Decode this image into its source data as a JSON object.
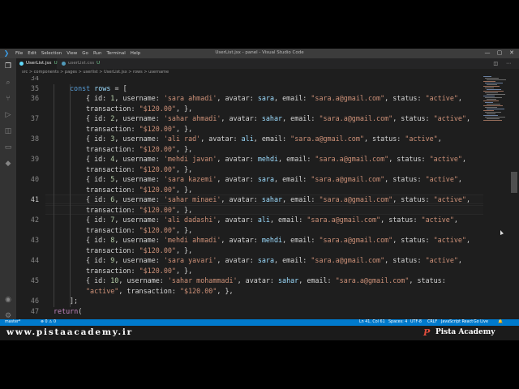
{
  "window": {
    "title": "UserList.jsx - panel - Visual Studio Code",
    "menu": [
      "File",
      "Edit",
      "Selection",
      "View",
      "Go",
      "Run",
      "Terminal",
      "Help"
    ],
    "watermark": "Pista Academy"
  },
  "tabs": [
    {
      "label": "UserList.jsx",
      "status": "U",
      "active": true
    },
    {
      "label": "userList.css",
      "status": "U",
      "active": false
    }
  ],
  "breadcrumb": "src > components > pages > userlist > UserList.jsx > rows > username",
  "code_lines": [
    {
      "num": "34",
      "indent": 0,
      "tokens": []
    },
    {
      "num": "35",
      "indent": 1,
      "tokens": [
        [
          "k",
          "const "
        ],
        [
          "v",
          "rows"
        ],
        [
          "p",
          " = ["
        ]
      ]
    },
    {
      "num": "36",
      "indent": 2,
      "tokens": [
        [
          "p",
          "{ id: "
        ],
        [
          "n",
          "1"
        ],
        [
          "p",
          ", username: "
        ],
        [
          "s",
          "'sara ahmadi'"
        ],
        [
          "p",
          ", avatar: "
        ],
        [
          "v",
          "sara"
        ],
        [
          "p",
          ", email: "
        ],
        [
          "s",
          "\"sara.a@gmail.com\""
        ],
        [
          "p",
          ", status: "
        ],
        [
          "s",
          "\"active\""
        ],
        [
          "p",
          ","
        ]
      ]
    },
    {
      "num": "",
      "indent": 2,
      "tokens": [
        [
          "p",
          "transaction: "
        ],
        [
          "s",
          "\"$120.00\""
        ],
        [
          "p",
          ", },"
        ]
      ]
    },
    {
      "num": "37",
      "indent": 2,
      "tokens": [
        [
          "p",
          "{ id: "
        ],
        [
          "n",
          "2"
        ],
        [
          "p",
          ", username: "
        ],
        [
          "s",
          "'sahar ahmadi'"
        ],
        [
          "p",
          ", avatar: "
        ],
        [
          "v",
          "sahar"
        ],
        [
          "p",
          ", email: "
        ],
        [
          "s",
          "\"sara.a@gmail.com\""
        ],
        [
          "p",
          ", status: "
        ],
        [
          "s",
          "\"active\""
        ],
        [
          "p",
          ","
        ]
      ]
    },
    {
      "num": "",
      "indent": 2,
      "tokens": [
        [
          "p",
          "transaction: "
        ],
        [
          "s",
          "\"$120.00\""
        ],
        [
          "p",
          ", },"
        ]
      ]
    },
    {
      "num": "38",
      "indent": 2,
      "tokens": [
        [
          "p",
          "{ id: "
        ],
        [
          "n",
          "3"
        ],
        [
          "p",
          ", username: "
        ],
        [
          "s",
          "'ali rad'"
        ],
        [
          "p",
          ", avatar: "
        ],
        [
          "v",
          "ali"
        ],
        [
          "p",
          ", email: "
        ],
        [
          "s",
          "\"sara.a@gmail.com\""
        ],
        [
          "p",
          ", status: "
        ],
        [
          "s",
          "\"active\""
        ],
        [
          "p",
          ","
        ]
      ]
    },
    {
      "num": "",
      "indent": 2,
      "tokens": [
        [
          "p",
          "transaction: "
        ],
        [
          "s",
          "\"$120.00\""
        ],
        [
          "p",
          ", },"
        ]
      ]
    },
    {
      "num": "39",
      "indent": 2,
      "tokens": [
        [
          "p",
          "{ id: "
        ],
        [
          "n",
          "4"
        ],
        [
          "p",
          ", username: "
        ],
        [
          "s",
          "'mehdi javan'"
        ],
        [
          "p",
          ", avatar: "
        ],
        [
          "v",
          "mehdi"
        ],
        [
          "p",
          ", email: "
        ],
        [
          "s",
          "\"sara.a@gmail.com\""
        ],
        [
          "p",
          ", status: "
        ],
        [
          "s",
          "\"active\""
        ],
        [
          "p",
          ","
        ]
      ]
    },
    {
      "num": "",
      "indent": 2,
      "tokens": [
        [
          "p",
          "transaction: "
        ],
        [
          "s",
          "\"$120.00\""
        ],
        [
          "p",
          ", },"
        ]
      ]
    },
    {
      "num": "40",
      "indent": 2,
      "tokens": [
        [
          "p",
          "{ id: "
        ],
        [
          "n",
          "5"
        ],
        [
          "p",
          ", username: "
        ],
        [
          "s",
          "'sara kazemi'"
        ],
        [
          "p",
          ", avatar: "
        ],
        [
          "v",
          "sara"
        ],
        [
          "p",
          ", email: "
        ],
        [
          "s",
          "\"sara.a@gmail.com\""
        ],
        [
          "p",
          ", status: "
        ],
        [
          "s",
          "\"active\""
        ],
        [
          "p",
          ","
        ]
      ]
    },
    {
      "num": "",
      "indent": 2,
      "tokens": [
        [
          "p",
          "transaction: "
        ],
        [
          "s",
          "\"$120.00\""
        ],
        [
          "p",
          ", },"
        ]
      ]
    },
    {
      "num": "41",
      "indent": 2,
      "current": true,
      "tokens": [
        [
          "p",
          "{ id: "
        ],
        [
          "n",
          "6"
        ],
        [
          "p",
          ", username: "
        ],
        [
          "s",
          "'sahar minaei'"
        ],
        [
          "p",
          ", avatar: "
        ],
        [
          "v",
          "sahar"
        ],
        [
          "p",
          ", email: "
        ],
        [
          "s",
          "\"sara.a@gmail.com\""
        ],
        [
          "p",
          ", status: "
        ],
        [
          "s",
          "\"active\""
        ],
        [
          "p",
          ","
        ]
      ]
    },
    {
      "num": "",
      "indent": 2,
      "current": true,
      "tokens": [
        [
          "p",
          "transaction: "
        ],
        [
          "s",
          "\"$120.00\""
        ],
        [
          "p",
          ", },"
        ]
      ]
    },
    {
      "num": "42",
      "indent": 2,
      "tokens": [
        [
          "p",
          "{ id: "
        ],
        [
          "n",
          "7"
        ],
        [
          "p",
          ", username: "
        ],
        [
          "s",
          "'ali dadashi'"
        ],
        [
          "p",
          ", avatar: "
        ],
        [
          "v",
          "ali"
        ],
        [
          "p",
          ", email: "
        ],
        [
          "s",
          "\"sara.a@gmail.com\""
        ],
        [
          "p",
          ", status: "
        ],
        [
          "s",
          "\"active\""
        ],
        [
          "p",
          ","
        ]
      ]
    },
    {
      "num": "",
      "indent": 2,
      "tokens": [
        [
          "p",
          "transaction: "
        ],
        [
          "s",
          "\"$120.00\""
        ],
        [
          "p",
          ", },"
        ]
      ]
    },
    {
      "num": "43",
      "indent": 2,
      "tokens": [
        [
          "p",
          "{ id: "
        ],
        [
          "n",
          "8"
        ],
        [
          "p",
          ", username: "
        ],
        [
          "s",
          "'mehdi ahmadi'"
        ],
        [
          "p",
          ", avatar: "
        ],
        [
          "v",
          "mehdi"
        ],
        [
          "p",
          ", email: "
        ],
        [
          "s",
          "\"sara.a@gmail.com\""
        ],
        [
          "p",
          ", status: "
        ],
        [
          "s",
          "\"active\""
        ],
        [
          "p",
          ","
        ]
      ]
    },
    {
      "num": "",
      "indent": 2,
      "tokens": [
        [
          "p",
          "transaction: "
        ],
        [
          "s",
          "\"$120.00\""
        ],
        [
          "p",
          ", },"
        ]
      ]
    },
    {
      "num": "44",
      "indent": 2,
      "tokens": [
        [
          "p",
          "{ id: "
        ],
        [
          "n",
          "9"
        ],
        [
          "p",
          ", username: "
        ],
        [
          "s",
          "'sara yavari'"
        ],
        [
          "p",
          ", avatar: "
        ],
        [
          "v",
          "sara"
        ],
        [
          "p",
          ", email: "
        ],
        [
          "s",
          "\"sara.a@gmail.com\""
        ],
        [
          "p",
          ", status: "
        ],
        [
          "s",
          "\"active\""
        ],
        [
          "p",
          ","
        ]
      ]
    },
    {
      "num": "",
      "indent": 2,
      "tokens": [
        [
          "p",
          "transaction: "
        ],
        [
          "s",
          "\"$120.00\""
        ],
        [
          "p",
          ", },"
        ]
      ]
    },
    {
      "num": "45",
      "indent": 2,
      "tokens": [
        [
          "p",
          "{ id: "
        ],
        [
          "n",
          "10"
        ],
        [
          "p",
          ", username: "
        ],
        [
          "s",
          "'sahar mohammadi'"
        ],
        [
          "p",
          ", avatar: "
        ],
        [
          "v",
          "sahar"
        ],
        [
          "p",
          ", email: "
        ],
        [
          "s",
          "\"sara.a@gmail.com\""
        ],
        [
          "p",
          ", status:"
        ]
      ]
    },
    {
      "num": "",
      "indent": 2,
      "tokens": [
        [
          "s",
          "\"active\""
        ],
        [
          "p",
          ", transaction: "
        ],
        [
          "s",
          "\"$120.00\""
        ],
        [
          "p",
          ", },"
        ]
      ]
    },
    {
      "num": "46",
      "indent": 1,
      "tokens": [
        [
          "p",
          "];"
        ]
      ]
    },
    {
      "num": "47",
      "indent": 0,
      "tokens": [
        [
          "f",
          "return"
        ],
        [
          "p",
          "("
        ]
      ]
    }
  ],
  "status_bar": {
    "branch": "master*",
    "problems": "⊗ 0 ⚠ 0",
    "position": "Ln 41, Col 61",
    "spaces": "Spaces: 4",
    "encoding": "UTF-8",
    "eol": "CRLF",
    "language": "JavaScript React",
    "golive": "Go Live"
  },
  "banner": {
    "url": "www.pistaacademy.ir",
    "brand": "Pista Academy"
  },
  "colors": {
    "accent": "#007acc",
    "keyword": "#569cd6",
    "string": "#ce9178",
    "number": "#b5cea8",
    "variable": "#9cdcfe",
    "brand": "#e04d3c"
  }
}
